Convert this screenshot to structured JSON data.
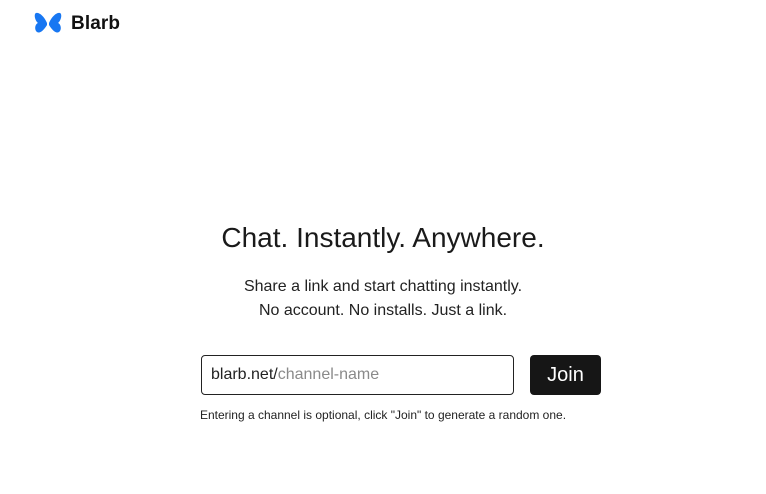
{
  "header": {
    "logo_icon": "butterfly-icon",
    "logo_color": "#1877f2",
    "brand_name": "Blarb"
  },
  "hero": {
    "headline": "Chat. Instantly. Anywhere.",
    "subline_1": "Share a link and start chatting instantly.",
    "subline_2": "No account. No installs. Just a link."
  },
  "join_form": {
    "prefix": "blarb.net/",
    "channel_value": "",
    "channel_placeholder": "channel-name",
    "join_label": "Join",
    "button_color": "#161616"
  },
  "hint": "Entering a channel is optional, click \"Join\" to generate a random one."
}
